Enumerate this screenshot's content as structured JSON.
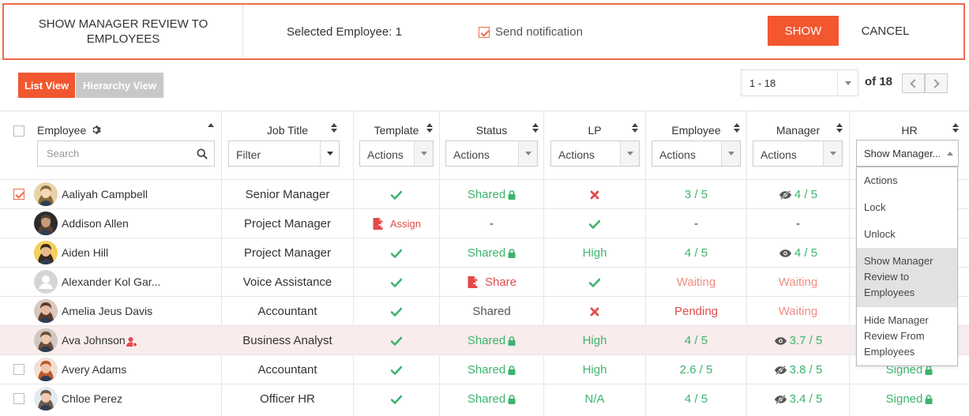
{
  "topbar": {
    "title": "SHOW MANAGER REVIEW TO EMPLOYEES",
    "selected_text": "Selected Employee: 1",
    "notify_label": "Send notification",
    "notify_checked": true,
    "show_label": "SHOW",
    "cancel_label": "CANCEL"
  },
  "views": {
    "list": "List View",
    "hierarchy": "Hierarchy View",
    "active": "list"
  },
  "pager": {
    "range": "1 - 18",
    "of_label": "of 18"
  },
  "columns": {
    "employee": "Employee",
    "job_title": "Job Title",
    "template": "Template",
    "status": "Status",
    "lp": "LP",
    "employee_score": "Employee",
    "manager": "Manager",
    "hr": "HR"
  },
  "filters": {
    "search_placeholder": "Search",
    "job_filter": "Filter",
    "template": "Actions",
    "status": "Actions",
    "lp": "Actions",
    "employee_score": "Actions",
    "manager": "Actions",
    "hr": "Show Manager..."
  },
  "hr_menu": {
    "items": [
      "Actions",
      "Lock",
      "Unlock",
      "Show Manager Review to Employees",
      "Hide Manager Review From Employees"
    ],
    "selected_index": 3
  },
  "colors": {
    "accent": "#f2572f",
    "green": "#3db46d",
    "red": "#e24a4a",
    "pink": "#f08d85",
    "highlight_row": "#f9ecec"
  },
  "rows": [
    {
      "name": "Aaliyah Campbell",
      "checked": true,
      "job": "Senior Manager",
      "template": "check",
      "status": "Shared",
      "status_lock": true,
      "status_style": "green",
      "lp": "x",
      "lp_style": "red",
      "emp_score": "3 / 5",
      "emp_style": "green",
      "mgr": "4 / 5",
      "mgr_icon": "eye-slash",
      "mgr_style": "green",
      "hr": "",
      "hr_lock": false,
      "avatar": "a1"
    },
    {
      "name": "Addison Allen",
      "checked": false,
      "job": "Project Manager",
      "template": "assign",
      "template_text": "Assign",
      "status": "-",
      "status_lock": false,
      "status_style": "dark",
      "lp": "check",
      "lp_style": "green",
      "emp_score": "-",
      "emp_style": "dark",
      "mgr": "-",
      "mgr_icon": "",
      "mgr_style": "dark",
      "hr": "",
      "hr_lock": false,
      "avatar": "a2"
    },
    {
      "name": "Aiden Hill",
      "checked": false,
      "job": "Project Manager",
      "template": "check",
      "status": "Shared",
      "status_lock": true,
      "status_style": "green",
      "lp": "High",
      "lp_style": "green",
      "emp_score": "4 / 5",
      "emp_style": "green",
      "mgr": "4 / 5",
      "mgr_icon": "eye",
      "mgr_style": "green",
      "hr": "",
      "hr_lock": false,
      "avatar": "a3"
    },
    {
      "name": "Alexander Kol Gar...",
      "checked": false,
      "job": "Voice Assistance",
      "template": "check",
      "status": "Share",
      "status_share": true,
      "status_lock": false,
      "status_style": "red",
      "lp": "check",
      "lp_style": "green",
      "emp_score": "Waiting",
      "emp_style": "pink",
      "mgr": "Waiting",
      "mgr_icon": "",
      "mgr_style": "pink",
      "hr": "",
      "hr_lock": false,
      "avatar": "placeholder"
    },
    {
      "name": "Amelia Jeus Davis",
      "checked": false,
      "job": "Accountant",
      "template": "check",
      "status": "Shared",
      "status_lock": false,
      "status_style": "muted",
      "lp": "x",
      "lp_style": "red",
      "emp_score": "Pending",
      "emp_style": "red",
      "mgr": "Waiting",
      "mgr_icon": "",
      "mgr_style": "pink",
      "hr": "",
      "hr_lock": false,
      "avatar": "a5"
    },
    {
      "name": "Ava Johnson",
      "checked": false,
      "highlight": true,
      "user_badge": true,
      "job": "Business Analyst",
      "template": "check",
      "status": "Shared",
      "status_lock": true,
      "status_style": "green",
      "lp": "High",
      "lp_style": "green",
      "emp_score": "4 / 5",
      "emp_style": "green",
      "mgr": "3.7 / 5",
      "mgr_icon": "eye",
      "mgr_style": "green",
      "hr": "",
      "hr_lock": false,
      "avatar": "a6"
    },
    {
      "name": "Avery Adams",
      "checked": false,
      "show_box": true,
      "job": "Accountant",
      "template": "check",
      "status": "Shared",
      "status_lock": true,
      "status_style": "green",
      "lp": "High",
      "lp_style": "green",
      "emp_score": "2.6 / 5",
      "emp_style": "green",
      "mgr": "3.8 / 5",
      "mgr_icon": "eye-slash",
      "mgr_style": "green",
      "hr": "Signed",
      "hr_lock": true,
      "avatar": "a7"
    },
    {
      "name": "Chloe Perez",
      "checked": false,
      "show_box": true,
      "job": "Officer HR",
      "template": "check",
      "status": "Shared",
      "status_lock": true,
      "status_style": "green",
      "lp": "N/A",
      "lp_style": "green",
      "emp_score": "4 / 5",
      "emp_style": "green",
      "mgr": "3.4 / 5",
      "mgr_icon": "eye-slash",
      "mgr_style": "green",
      "hr": "Signed",
      "hr_lock": true,
      "avatar": "a8"
    }
  ]
}
